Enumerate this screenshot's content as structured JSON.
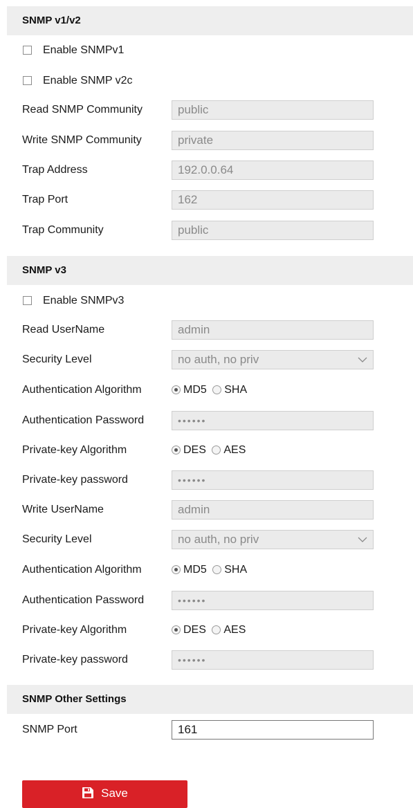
{
  "sections": {
    "v1v2": "SNMP v1/v2",
    "v3": "SNMP v3",
    "other": "SNMP Other Settings"
  },
  "v1v2": {
    "enable_v1": {
      "label": "Enable SNMPv1",
      "checked": false
    },
    "enable_v2c": {
      "label": "Enable SNMP v2c",
      "checked": false
    },
    "read_community": {
      "label": "Read SNMP Community",
      "value": "public"
    },
    "write_community": {
      "label": "Write SNMP Community",
      "value": "private"
    },
    "trap_address": {
      "label": "Trap Address",
      "value": "192.0.0.64"
    },
    "trap_port": {
      "label": "Trap Port",
      "value": "162"
    },
    "trap_community": {
      "label": "Trap Community",
      "value": "public"
    }
  },
  "v3": {
    "enable_v3": {
      "label": "Enable SNMPv3",
      "checked": false
    },
    "read": {
      "username_label": "Read UserName",
      "username": "admin",
      "security_level_label": "Security Level",
      "security_level": "no auth, no priv",
      "auth_algo_label": "Authentication Algorithm",
      "auth_options": [
        "MD5",
        "SHA"
      ],
      "auth_selected": "MD5",
      "auth_password_label": "Authentication Password",
      "auth_password": "••••••",
      "priv_algo_label": "Private-key Algorithm",
      "priv_options": [
        "DES",
        "AES"
      ],
      "priv_selected": "DES",
      "priv_password_label": "Private-key password",
      "priv_password": "••••••"
    },
    "write": {
      "username_label": "Write UserName",
      "username": "admin",
      "security_level_label": "Security Level",
      "security_level": "no auth, no priv",
      "auth_algo_label": "Authentication Algorithm",
      "auth_options": [
        "MD5",
        "SHA"
      ],
      "auth_selected": "MD5",
      "auth_password_label": "Authentication Password",
      "auth_password": "••••••",
      "priv_algo_label": "Private-key Algorithm",
      "priv_options": [
        "DES",
        "AES"
      ],
      "priv_selected": "DES",
      "priv_password_label": "Private-key password",
      "priv_password": "••••••"
    }
  },
  "other": {
    "snmp_port": {
      "label": "SNMP Port",
      "value": "161"
    }
  },
  "save_button": {
    "label": "Save",
    "icon": "floppy-disk-icon",
    "color": "#d92127"
  },
  "colors": {
    "section_bg": "#eeeeee",
    "disabled_field_bg": "#ebebeb",
    "disabled_text": "#8a8a8a"
  }
}
